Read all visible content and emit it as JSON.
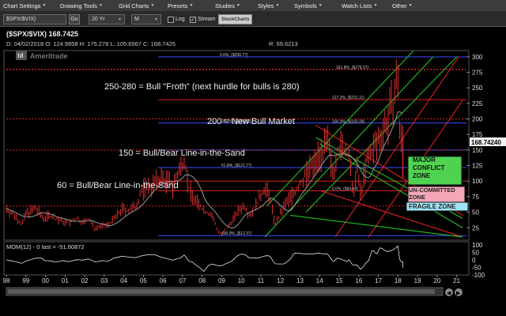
{
  "menu": [
    {
      "label": "Chart Settings"
    },
    {
      "label": "Drawing Tools"
    },
    {
      "label": "Grid Charts"
    },
    {
      "label": "Presets"
    },
    {
      "label": "Studies"
    },
    {
      "label": "Styles"
    },
    {
      "label": "Symbols"
    },
    {
      "label": "Watch Lists"
    },
    {
      "label": "Other"
    }
  ],
  "toolbar": {
    "symbol": "$SPX/$VIX)",
    "go_label": "Go",
    "period": "20 Yr",
    "interval": "M",
    "log_label": "Log",
    "log_checked": false,
    "stream_label": "Stream",
    "stream_checked": true,
    "stockcharts_label": "StockCharts"
  },
  "header": {
    "symbol_line": "($SPX/$VIX) 168.7425",
    "ohlc_line": "D: 04/02/2018 O: 124.9858 H: 175.278 L: 105.6567 C: 168.7425",
    "range_line": "R: 69.6213",
    "logo": "Ameritrade"
  },
  "price_box": "168.74240",
  "y_ticks": [
    300,
    275,
    250,
    225,
    200,
    175,
    150,
    125,
    100,
    75,
    50,
    25
  ],
  "mom_ticks": [
    100,
    50,
    0,
    -50,
    -100
  ],
  "x_ticks": [
    "98",
    "99",
    "00",
    "01",
    "02",
    "03",
    "04",
    "05",
    "06",
    "07",
    "08",
    "09",
    "10",
    "11",
    "12",
    "13",
    "14",
    "15",
    "16",
    "17",
    "18",
    "19",
    "20",
    "21"
  ],
  "momentum_label": "MOM(12) - 0 last = -51.60872",
  "annotations": {
    "froth": "250-280 = Bull \"Froth\" (next hurdle for bulls is 280)",
    "new_bull": "200 = New Bull Market",
    "line150": "150 = Bull/Bear Line-in-the-Sand",
    "line60": "60 = Bull/Bear Line-in-the-Sand"
  },
  "zones": {
    "major": "MAJOR CONFLICT ZONE",
    "uncommitted": "UN-COMMITTED ZONE",
    "fragile": "FRAGILE ZONE"
  },
  "fib_labels": [
    {
      "text": "0.0%_($299.77)",
      "value": 299.77
    },
    {
      "text": "161.8%_($279.37)",
      "value": 279.37
    },
    {
      "text": "127.2%_($231.11)",
      "value": 231.11
    },
    {
      "text": "38.2%_($193.39)",
      "value": 193.39
    },
    {
      "text": "100.0%_($192.38)",
      "value": 192.38
    },
    {
      "text": "61.8%_($121.77)",
      "value": 121.77
    },
    {
      "text": "0.0%_($84.44)",
      "value": 84.44
    },
    {
      "text": "100.0%_($12.37)",
      "value": 12.37
    }
  ],
  "chart_data": {
    "type": "bar",
    "title": "($SPX/$VIX) 168.7425",
    "ylim": [
      5,
      310
    ],
    "x_range": [
      1998.0,
      2021.5
    ],
    "horizontal_levels": [
      {
        "value": 299.77,
        "color": "#3b4cff",
        "style": "solid"
      },
      {
        "value": 279.37,
        "color": "#d92020",
        "style": "dotted"
      },
      {
        "value": 280,
        "color": "#d92020",
        "style": "dotted"
      },
      {
        "value": 231.11,
        "color": "#d92020",
        "style": "solid"
      },
      {
        "value": 193.39,
        "color": "#3b4cff",
        "style": "solid"
      },
      {
        "value": 200,
        "color": "#d92020",
        "style": "dotted"
      },
      {
        "value": 150,
        "color": "#3b4cff",
        "style": "solid"
      },
      {
        "value": 150,
        "color": "#d92020",
        "style": "dotted"
      },
      {
        "value": 121.77,
        "color": "#3b4cff",
        "style": "solid"
      },
      {
        "value": 100,
        "color": "#d92020",
        "style": "solid"
      },
      {
        "value": 84.44,
        "color": "#d92020",
        "style": "solid"
      },
      {
        "value": 60,
        "color": "#d92020",
        "style": "dotted"
      },
      {
        "value": 12.37,
        "color": "#3b4cff",
        "style": "solid"
      }
    ],
    "channel_lines": [
      {
        "color": "#22c222",
        "from": [
          2011.3,
          60
        ],
        "to": [
          2018.8,
          310
        ]
      },
      {
        "color": "#22c222",
        "from": [
          2011.2,
          10
        ],
        "to": [
          2019.8,
          300
        ]
      },
      {
        "color": "#22c222",
        "from": [
          2013.3,
          50
        ],
        "to": [
          2021.0,
          300
        ]
      },
      {
        "color": "#d92020",
        "from": [
          2014.8,
          10
        ],
        "to": [
          2021.1,
          300
        ]
      },
      {
        "color": "#d92020",
        "from": [
          2016.5,
          10
        ],
        "to": [
          2021.3,
          230
        ]
      },
      {
        "color": "#22c222",
        "from": [
          2013.8,
          170
        ],
        "to": [
          2021.3,
          40
        ]
      },
      {
        "color": "#d92020",
        "from": [
          2013.8,
          190
        ],
        "to": [
          2021.3,
          45
        ]
      },
      {
        "color": "#22c222",
        "from": [
          2014.0,
          160
        ],
        "to": [
          2021.3,
          25
        ]
      },
      {
        "color": "#d92020",
        "from": [
          2014.0,
          85
        ],
        "to": [
          2021.3,
          10
        ]
      },
      {
        "color": "#22c222",
        "from": [
          2012.5,
          45
        ],
        "to": [
          2021.3,
          10
        ]
      }
    ],
    "price_series": [
      [
        1998.0,
        56
      ],
      [
        1998.5,
        42
      ],
      [
        1998.8,
        30
      ],
      [
        1999.0,
        48
      ],
      [
        1999.5,
        55
      ],
      [
        1999.9,
        40
      ],
      [
        2000.2,
        45
      ],
      [
        2000.6,
        38
      ],
      [
        2000.9,
        35
      ],
      [
        2001.2,
        32
      ],
      [
        2001.6,
        40
      ],
      [
        2001.9,
        33
      ],
      [
        2002.2,
        40
      ],
      [
        2002.5,
        25
      ],
      [
        2002.9,
        28
      ],
      [
        2003.2,
        30
      ],
      [
        2003.6,
        42
      ],
      [
        2003.9,
        55
      ],
      [
        2004.2,
        52
      ],
      [
        2004.6,
        58
      ],
      [
        2004.9,
        85
      ],
      [
        2005.2,
        90
      ],
      [
        2005.6,
        96
      ],
      [
        2005.9,
        105
      ],
      [
        2006.2,
        100
      ],
      [
        2006.5,
        92
      ],
      [
        2006.9,
        120
      ],
      [
        2007.1,
        140
      ],
      [
        2007.3,
        90
      ],
      [
        2007.6,
        70
      ],
      [
        2007.9,
        60
      ],
      [
        2008.2,
        50
      ],
      [
        2008.5,
        45
      ],
      [
        2008.8,
        20
      ],
      [
        2009.0,
        14
      ],
      [
        2009.3,
        25
      ],
      [
        2009.6,
        40
      ],
      [
        2009.9,
        55
      ],
      [
        2010.2,
        60
      ],
      [
        2010.4,
        45
      ],
      [
        2010.7,
        58
      ],
      [
        2010.9,
        70
      ],
      [
        2011.2,
        90
      ],
      [
        2011.5,
        70
      ],
      [
        2011.7,
        30
      ],
      [
        2011.9,
        40
      ],
      [
        2012.2,
        60
      ],
      [
        2012.5,
        75
      ],
      [
        2012.8,
        85
      ],
      [
        2013.1,
        100
      ],
      [
        2013.4,
        115
      ],
      [
        2013.7,
        125
      ],
      [
        2013.9,
        140
      ],
      [
        2014.2,
        150
      ],
      [
        2014.4,
        160
      ],
      [
        2014.7,
        110
      ],
      [
        2014.9,
        155
      ],
      [
        2015.2,
        150
      ],
      [
        2015.5,
        145
      ],
      [
        2015.7,
        70
      ],
      [
        2015.9,
        120
      ],
      [
        2016.1,
        80
      ],
      [
        2016.4,
        130
      ],
      [
        2016.7,
        150
      ],
      [
        2016.9,
        160
      ],
      [
        2017.2,
        180
      ],
      [
        2017.5,
        200
      ],
      [
        2017.7,
        220
      ],
      [
        2017.9,
        250
      ],
      [
        2018.0,
        270
      ],
      [
        2018.1,
        160
      ],
      [
        2018.25,
        168.74
      ]
    ],
    "momentum": {
      "name": "MOM(12)",
      "last": -51.60872,
      "ylim": [
        -100,
        100
      ]
    }
  }
}
